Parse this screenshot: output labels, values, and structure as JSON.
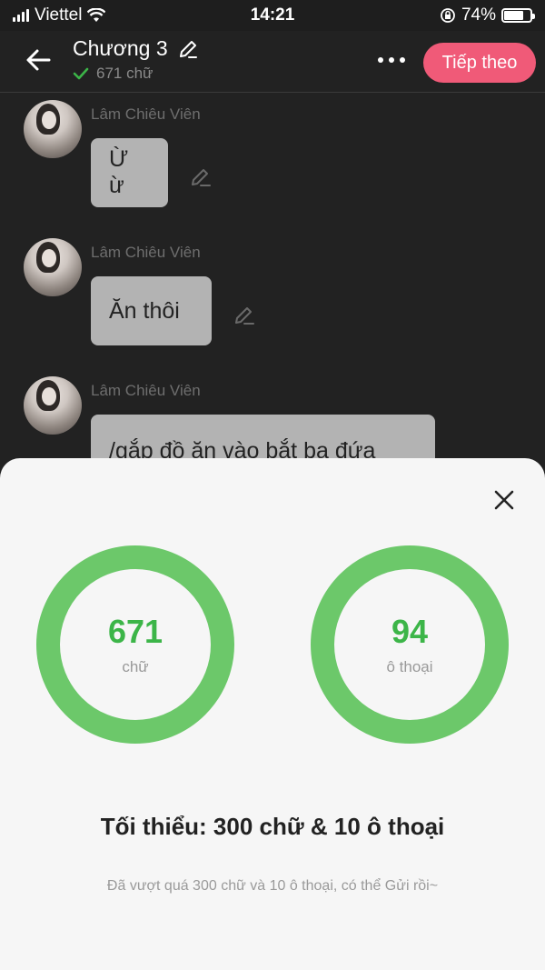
{
  "status_bar": {
    "carrier": "Viettel",
    "time": "14:21",
    "battery": "74%",
    "battery_level": 0.74
  },
  "header": {
    "title": "Chương 3",
    "word_count": "671 chữ",
    "next_label": "Tiếp theo"
  },
  "messages": [
    {
      "sender": "Lâm Chiêu Viên",
      "text": "Ừ ừ"
    },
    {
      "sender": "Lâm Chiêu Viên",
      "text": "Ăn thôi"
    },
    {
      "sender": "Lâm Chiêu Viên",
      "text": "/gắp đồ ăn vào bắt ba đứa"
    }
  ],
  "stats_sheet": {
    "words": {
      "value": "671",
      "label": "chữ",
      "progress": 1.0
    },
    "dialogues": {
      "value": "94",
      "label": "ô thoại",
      "progress": 1.0
    },
    "minimum": "Tối thiểu: 300 chữ & 10 ô thoại",
    "note": "Đã vượt quá 300 chữ và 10 ô thoại, có thể Gửi rồi~",
    "ring_color": "#6cc86a",
    "value_color": "#3cb548"
  },
  "colors": {
    "accent": "#f05a78",
    "background": "#222222",
    "bubble": "#b3b3b3"
  },
  "icons": [
    "back-arrow-icon",
    "pencil-icon",
    "check-icon",
    "more-icon",
    "close-icon",
    "wifi-icon",
    "signal-icon",
    "battery-icon",
    "rotation-lock-icon"
  ]
}
